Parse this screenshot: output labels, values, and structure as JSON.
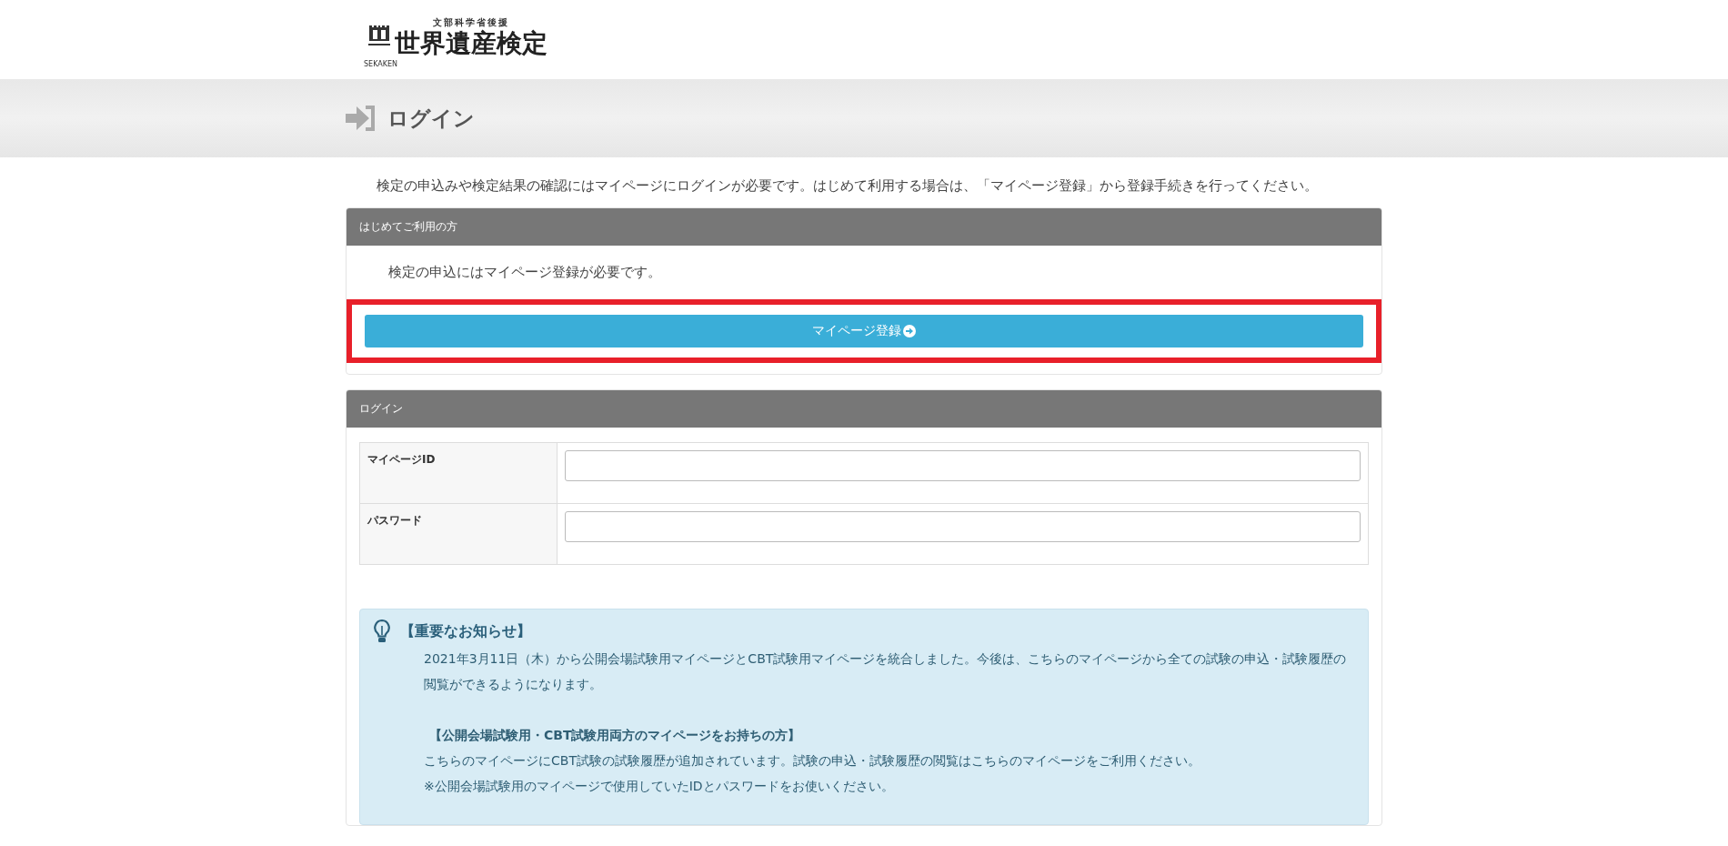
{
  "logo": {
    "sponsor": "文部科学省後援",
    "title": "世界遺産検定",
    "mark_caption": "SEKAKEN"
  },
  "page_title": "ログイン",
  "intro": "検定の申込みや検定結果の確認にはマイページにログインが必要です。はじめて利用する場合は、「マイページ登録」から登録手続きを行ってください。",
  "first_time": {
    "header": "はじめてご利用の方",
    "text": "検定の申込にはマイページ登録が必要です。",
    "button": "マイページ登録",
    "highlighted": true
  },
  "login": {
    "header": "ログイン",
    "fields": [
      {
        "label": "マイページID"
      },
      {
        "label": "パスワード"
      }
    ]
  },
  "notice": {
    "title": "【重要なお知らせ】",
    "items": [
      {
        "kind": "text",
        "text": "2021年3月11日（木）から公開会場試験用マイページとCBT試験用マイページを統合しました。今後は、こちらのマイページから全ての試験の申込・試験履歴の閲覧ができるようになります。"
      },
      {
        "kind": "heading",
        "text": "【公開会場試験用・CBT試験用両方のマイページをお持ちの方】"
      },
      {
        "kind": "text",
        "text": "こちらのマイページにCBT試験の試験履歴が追加されています。試験の申込・試験履歴の閲覧はこちらのマイページをご利用ください。"
      },
      {
        "kind": "text",
        "text": "※公開会場試験用のマイページで使用していたIDとパスワードをお使いください。"
      }
    ]
  }
}
